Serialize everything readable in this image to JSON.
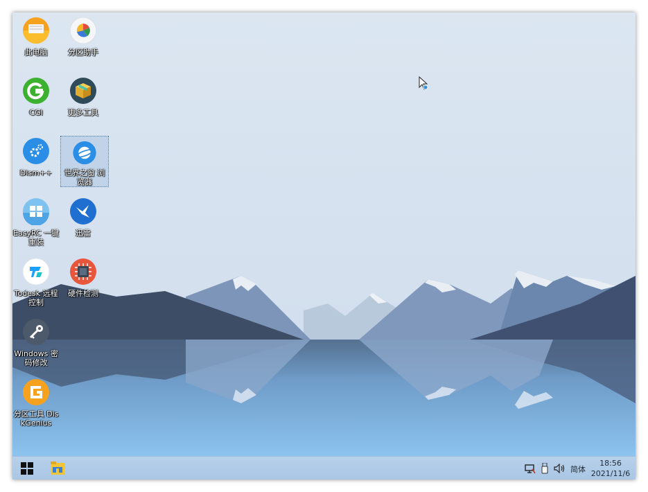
{
  "desktop": {
    "icons": [
      {
        "label": "此电脑",
        "icon": "this-pc-icon"
      },
      {
        "label": "分区助手",
        "icon": "partition-assistant-icon"
      },
      {
        "label": "CGI",
        "icon": "cgi-icon"
      },
      {
        "label": "更多工具",
        "icon": "more-tools-icon"
      },
      {
        "label": "Dism++",
        "icon": "dism-icon"
      },
      {
        "label": "世界之窗 浏览器",
        "icon": "theworld-browser-icon"
      },
      {
        "label": "EasyRC 一键重装",
        "icon": "easyrc-icon"
      },
      {
        "label": "迅雷",
        "icon": "thunder-icon"
      },
      {
        "label": "Todesk 远程控制",
        "icon": "todesk-icon"
      },
      {
        "label": "硬件检测",
        "icon": "hardware-detect-icon"
      },
      {
        "label": "Windows 密码修改",
        "icon": "key-icon"
      },
      {
        "label": "分区工具 DiskGenius",
        "icon": "diskgenius-icon"
      }
    ]
  },
  "taskbar": {
    "start": "windows-start-icon",
    "pinned": [
      "file-explorer-icon"
    ],
    "tray": {
      "ime": "简体",
      "time": "18:56",
      "date": "2021/11/6",
      "icons": [
        "network-icon",
        "usb-icon",
        "volume-icon"
      ]
    }
  },
  "colors": {
    "taskbar": "#b4cde8",
    "sky": "#d9e4ef",
    "mountain_dark": "#3f4f68",
    "lake": "#7fb4e0"
  }
}
